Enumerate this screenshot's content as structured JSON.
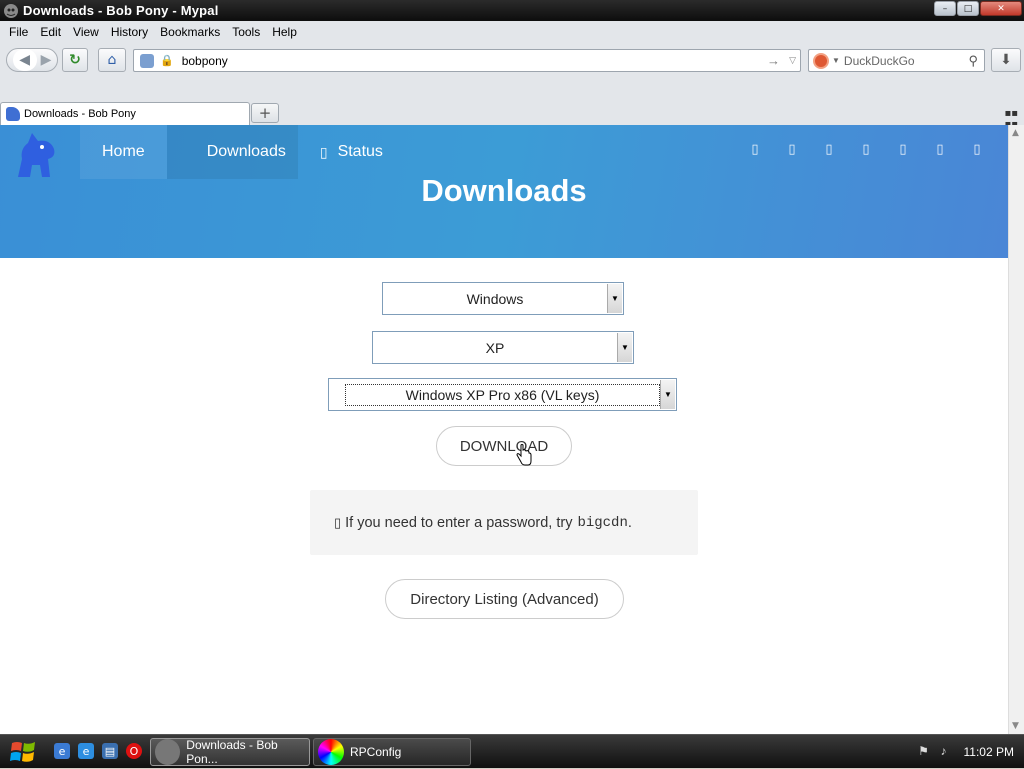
{
  "window": {
    "title": "Downloads - Bob Pony - Mypal",
    "minimize": "–",
    "maximize": "□",
    "close": "✕"
  },
  "menu": [
    "File",
    "Edit",
    "View",
    "History",
    "Bookmarks",
    "Tools",
    "Help"
  ],
  "toolbar": {
    "url": "bobpony",
    "search_placeholder": "DuckDuckGo"
  },
  "tab": {
    "label": "Downloads - Bob Pony",
    "new_tab": "+"
  },
  "site": {
    "nav": {
      "home": "Home",
      "downloads": "Downloads",
      "status": "Status"
    },
    "social_icons": [
      "social-icon-1",
      "social-icon-2",
      "social-icon-3",
      "social-icon-4",
      "social-icon-5",
      "social-icon-6",
      "social-icon-7"
    ],
    "heading": "Downloads",
    "selects": {
      "os": "Windows",
      "version": "XP",
      "edition": "Windows XP Pro x86 (VL keys)"
    },
    "download_button": "DOWNLOAD",
    "notice": {
      "text": "If you need to enter a password, try",
      "password": "bigcdn",
      "end": "."
    },
    "directory_button": "Directory Listing (Advanced)"
  },
  "taskbar": {
    "tasks": [
      "Downloads - Bob Pon...",
      "RPConfig"
    ],
    "clock": "11:02 PM"
  },
  "colors": {
    "hero": "#3c9cd6",
    "titlebar": "#1a1a1a",
    "taskbar": "#202020"
  }
}
